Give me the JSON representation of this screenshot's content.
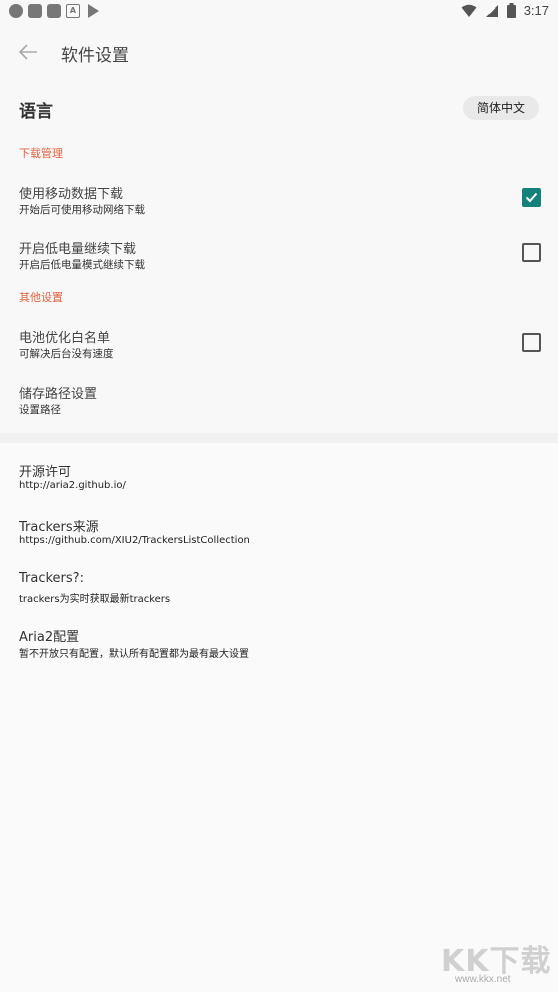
{
  "status_bar": {
    "time": "3:17"
  },
  "toolbar": {
    "title": "软件设置"
  },
  "language": {
    "label": "语言",
    "value": "简体中文"
  },
  "sections": {
    "download": {
      "header": "下载管理"
    },
    "other": {
      "header": "其他设置"
    }
  },
  "items": {
    "mobile_data": {
      "title": "使用移动数据下载",
      "subtitle": "开始后可使用移动网络下载",
      "checked": true
    },
    "low_battery": {
      "title": "开启低电量继续下载",
      "subtitle": "开启后低电量模式继续下载",
      "checked": false
    },
    "battery_whitelist": {
      "title": "电池优化白名单",
      "subtitle": "可解决后台没有速度",
      "checked": false
    },
    "storage_path": {
      "title": "储存路径设置",
      "subtitle": "设置路径"
    }
  },
  "info": {
    "license": {
      "title": "开源许可",
      "subtitle": "http://aria2.github.io/"
    },
    "trackers_source": {
      "title": "Trackers来源",
      "subtitle": "https://github.com/XIU2/TrackersListCollection"
    },
    "trackers_q": {
      "title": "Trackers?:",
      "subtitle": "trackers为实时获取最新trackers"
    },
    "aria2_config": {
      "title": "Aria2配置",
      "subtitle": "暂不开放只有配置，默认所有配置都为最有最大设置"
    }
  },
  "watermark": {
    "logo": "KK下载",
    "url": "www.kkx.net"
  },
  "colors": {
    "accent": "#14827a",
    "section_header": "#e2623f",
    "background": "#f8f8f8"
  }
}
